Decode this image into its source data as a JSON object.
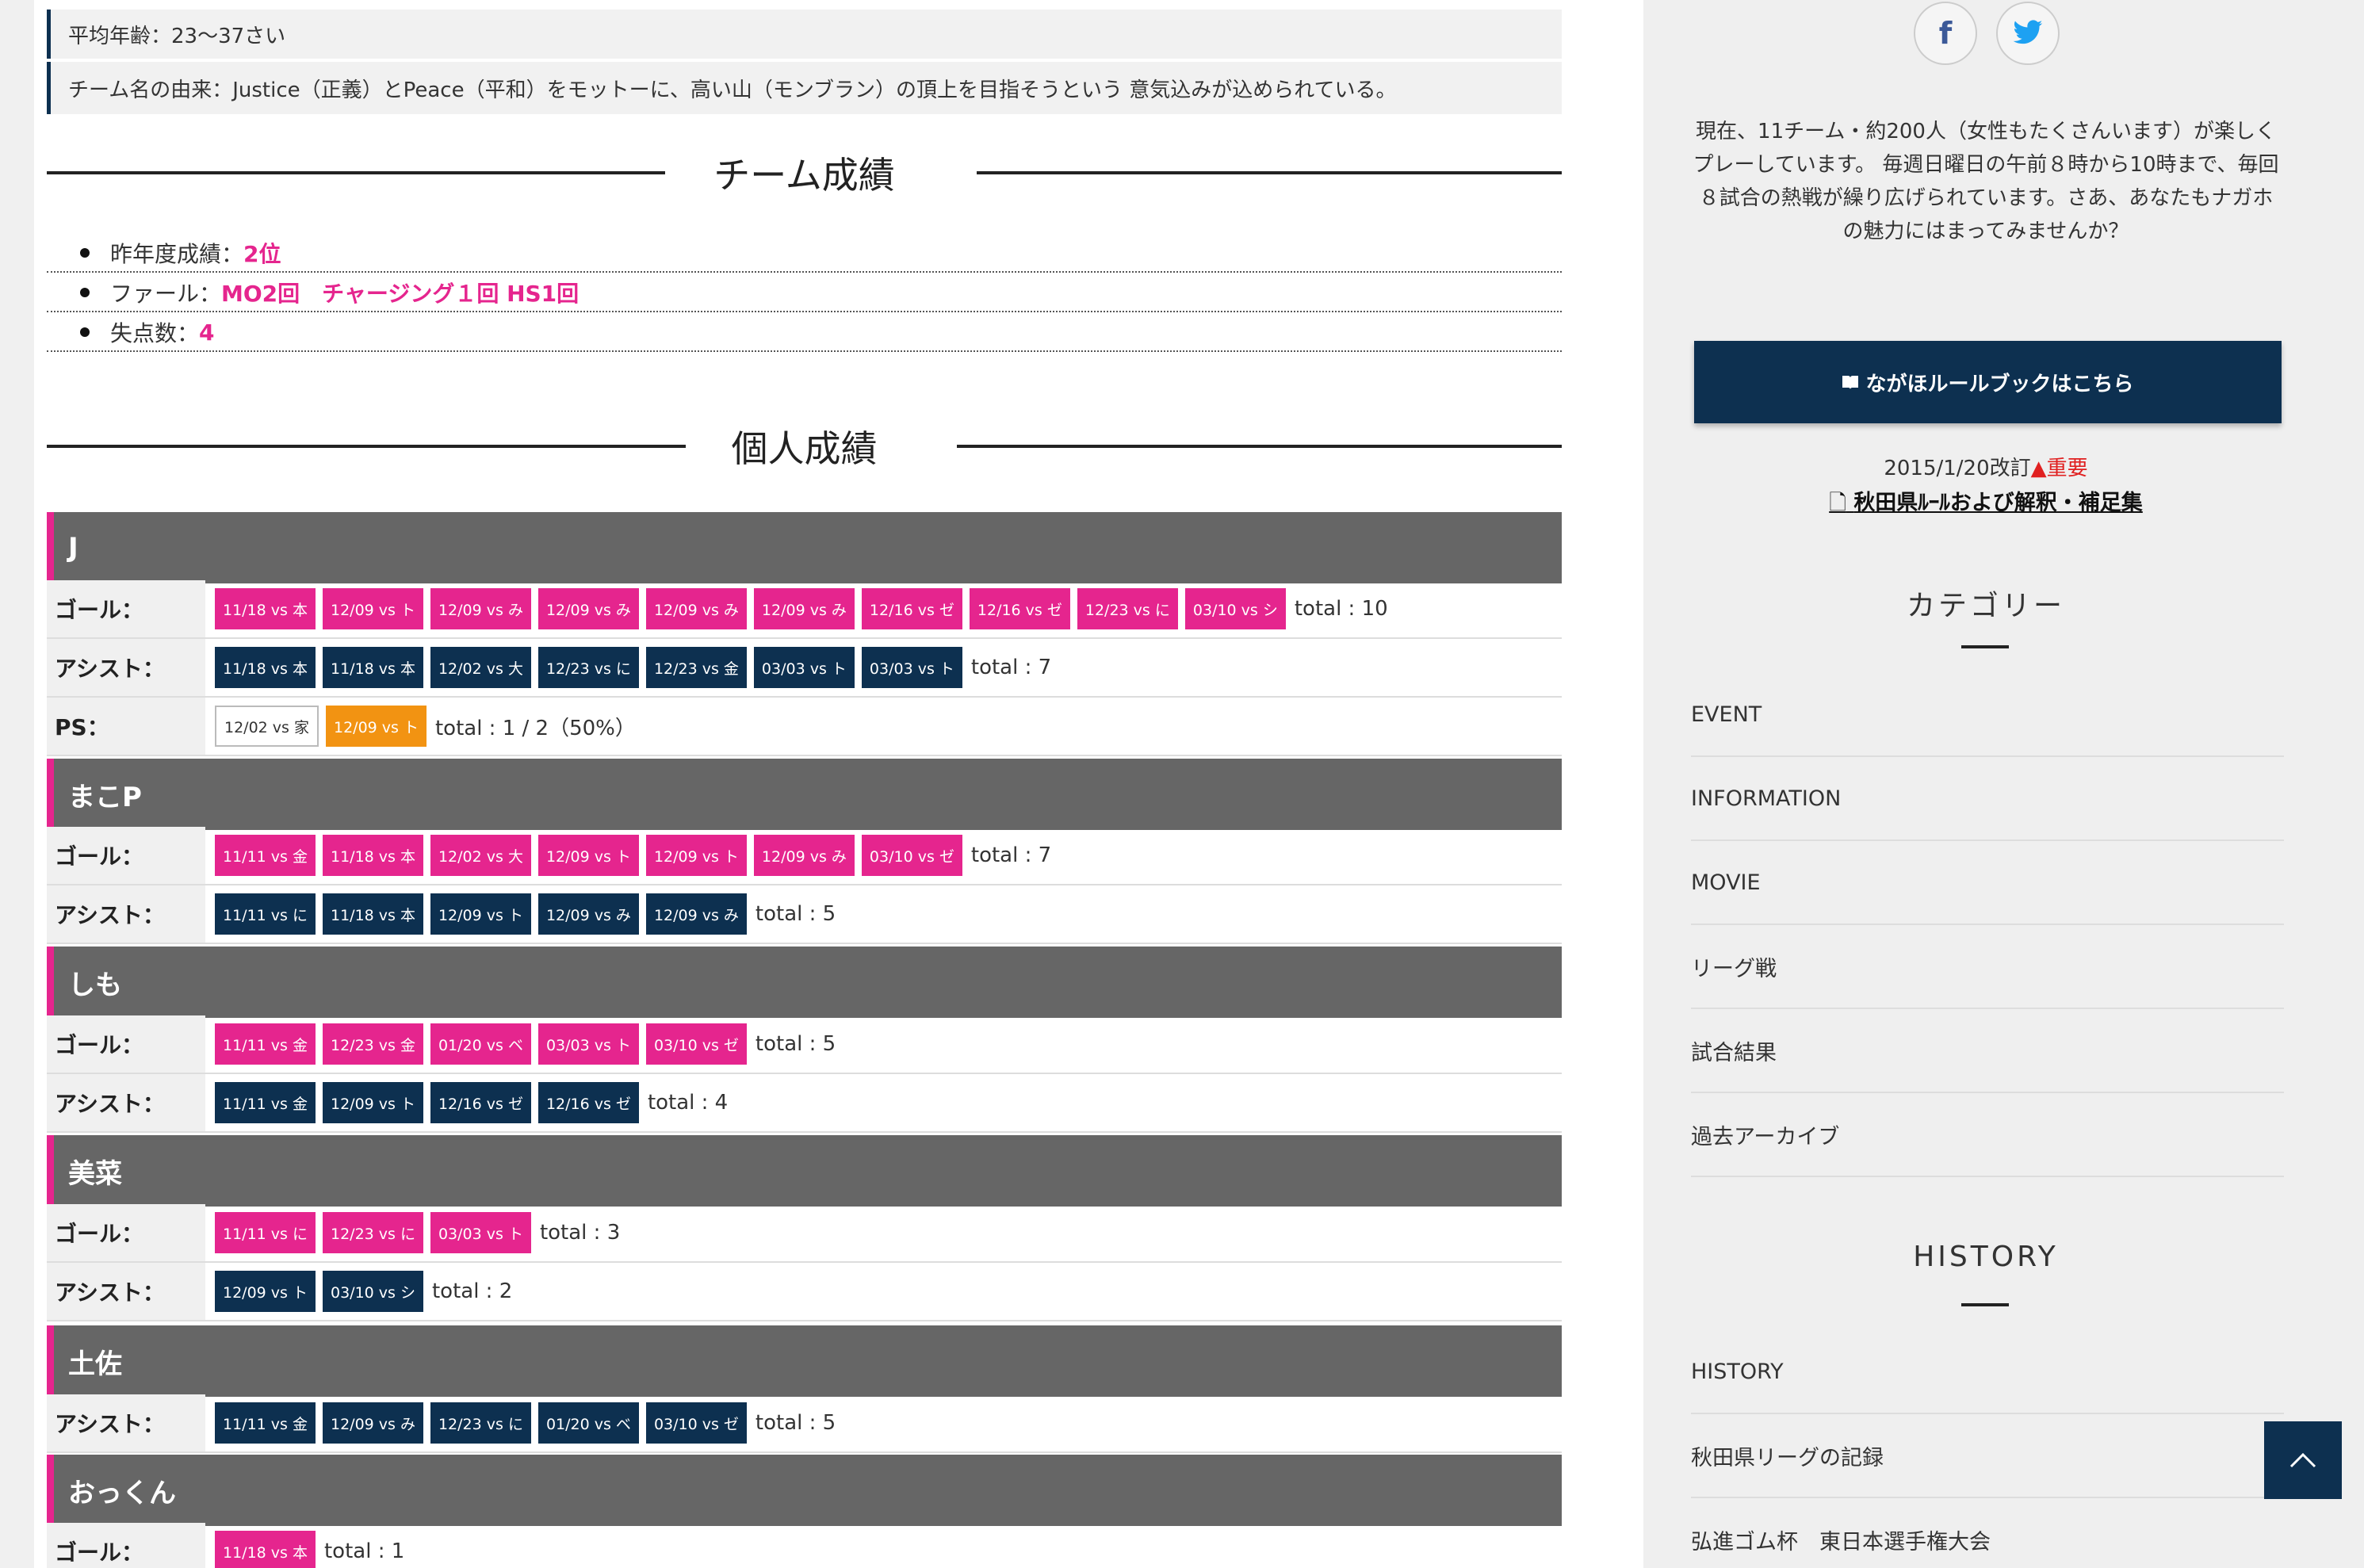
{
  "team_info": {
    "age": "平均年齢：23〜37さい",
    "name_origin": "チーム名の由来：Justice（正義）とPeace（平和）をモットーに、高い山（モンブラン）の頂上を目指そうという 意気込みが込められている。"
  },
  "team_results": {
    "heading": "チーム成績",
    "items": [
      {
        "label": "昨年度成績：",
        "value": "2位"
      },
      {
        "label": "ファール：",
        "value": "MO2回　チャージング１回 HS1回"
      },
      {
        "label": "失点数：",
        "value": "4"
      }
    ]
  },
  "personal": {
    "heading": "個人成績",
    "players": [
      {
        "name": "J",
        "rows": [
          {
            "label": "ゴール：",
            "kind": "goal",
            "chips": [
              "11/18 vs 本",
              "12/09 vs ト",
              "12/09 vs み",
              "12/09 vs み",
              "12/09 vs み",
              "12/09 vs み",
              "12/16 vs ゼ",
              "12/16 vs ゼ",
              "12/23 vs に",
              "03/10 vs シ"
            ],
            "total": "total : 10"
          },
          {
            "label": "アシスト：",
            "kind": "assist",
            "chips": [
              "11/18 vs 本",
              "11/18 vs 本",
              "12/02 vs 大",
              "12/23 vs に",
              "12/23 vs 金",
              "03/03 vs ト",
              "03/03 vs ト"
            ],
            "total": "total : 7"
          },
          {
            "label": "PS：",
            "kind": "ps",
            "chips": [
              "12/02 vs 家",
              "12/09 vs ト"
            ],
            "total": "total : 1 / 2（50%）"
          }
        ]
      },
      {
        "name": "まこP",
        "rows": [
          {
            "label": "ゴール：",
            "kind": "goal",
            "chips": [
              "11/11 vs 金",
              "11/18 vs 本",
              "12/02 vs 大",
              "12/09 vs ト",
              "12/09 vs ト",
              "12/09 vs み",
              "03/10 vs ゼ"
            ],
            "total": "total : 7"
          },
          {
            "label": "アシスト：",
            "kind": "assist",
            "chips": [
              "11/11 vs に",
              "11/18 vs 本",
              "12/09 vs ト",
              "12/09 vs み",
              "12/09 vs み"
            ],
            "total": "total : 5"
          }
        ]
      },
      {
        "name": "しも",
        "rows": [
          {
            "label": "ゴール：",
            "kind": "goal",
            "chips": [
              "11/11 vs 金",
              "12/23 vs 金",
              "01/20 vs ベ",
              "03/03 vs ト",
              "03/10 vs ゼ"
            ],
            "total": "total : 5"
          },
          {
            "label": "アシスト：",
            "kind": "assist",
            "chips": [
              "11/11 vs 金",
              "12/09 vs ト",
              "12/16 vs ゼ",
              "12/16 vs ゼ"
            ],
            "total": "total : 4"
          }
        ]
      },
      {
        "name": "美菜",
        "rows": [
          {
            "label": "ゴール：",
            "kind": "goal",
            "chips": [
              "11/11 vs に",
              "12/23 vs に",
              "03/03 vs ト"
            ],
            "total": "total : 3"
          },
          {
            "label": "アシスト：",
            "kind": "assist",
            "chips": [
              "12/09 vs ト",
              "03/10 vs シ"
            ],
            "total": "total : 2"
          }
        ]
      },
      {
        "name": "土佐",
        "rows": [
          {
            "label": "アシスト：",
            "kind": "assist",
            "chips": [
              "11/11 vs 金",
              "12/09 vs み",
              "12/23 vs に",
              "01/20 vs ベ",
              "03/10 vs ゼ"
            ],
            "total": "total : 5"
          }
        ]
      },
      {
        "name": "おっくん",
        "rows": [
          {
            "label": "ゴール：",
            "kind": "goal",
            "chips": [
              "11/18 vs 本"
            ],
            "total": "total : 1"
          }
        ]
      }
    ]
  },
  "sidebar": {
    "social": [
      "facebook-icon",
      "twitter-icon"
    ],
    "description": "現在、11チーム・約200人（女性もたくさんいます）が楽しくプレーしています。 毎週日曜日の午前８時から10時まで、毎回８試合の熱戦が繰り広げられています。さあ、あなたもナガホの魅力にはまってみませんか？",
    "rulebook_button": "ながほルールブックはこちら",
    "revision_date": "2015/1/20改訂",
    "revision_important": "重要",
    "rule_link": "秋田県ﾙｰﾙおよび解釈・補足集",
    "category_title": "カテゴリー",
    "categories": [
      "EVENT",
      "INFORMATION",
      "MOVIE",
      "リーグ戦",
      "試合結果",
      "過去アーカイブ"
    ],
    "history_title": "HISTORY",
    "history_items": [
      "HISTORY",
      "秋田県リーグの記録",
      "弘進ゴム杯　東日本選手権大会"
    ]
  },
  "colors": {
    "goal": "#e5258e",
    "assist": "#0d3050",
    "ps_hit": "#f29312",
    "header": "#666666",
    "accent": "#e5258e"
  }
}
